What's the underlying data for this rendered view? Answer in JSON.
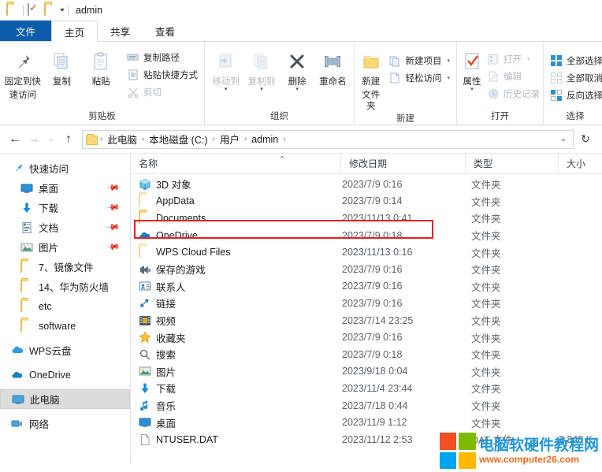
{
  "window": {
    "title": "admin",
    "quick_access": [
      "folder-icon",
      "properties-icon",
      "new-folder-icon",
      "dropdown-caret-icon"
    ]
  },
  "ribbon": {
    "tabs": [
      {
        "label": "文件",
        "kind": "file"
      },
      {
        "label": "主页",
        "kind": "active"
      },
      {
        "label": "共享",
        "kind": "normal"
      },
      {
        "label": "查看",
        "kind": "normal"
      }
    ],
    "groups": [
      {
        "title": "剪贴板",
        "big": [
          {
            "label1": "固定到快",
            "label2": "速访问",
            "icon": "pin-icon"
          },
          {
            "label1": "复制",
            "label2": "",
            "icon": "copy-icon"
          },
          {
            "label1": "粘贴",
            "label2": "",
            "icon": "paste-icon"
          }
        ],
        "small": [
          {
            "label": "复制路径",
            "icon": "copy-path-icon",
            "disabled": false
          },
          {
            "label": "粘贴快捷方式",
            "icon": "paste-shortcut-icon",
            "disabled": false
          },
          {
            "label": "剪切",
            "icon": "scissors-icon",
            "disabled": true
          }
        ]
      },
      {
        "title": "组织",
        "big": [
          {
            "label1": "移动到",
            "label2": "",
            "icon": "move-to-icon",
            "disabled": true,
            "caret": true
          },
          {
            "label1": "复制到",
            "label2": "",
            "icon": "copy-to-icon",
            "disabled": true,
            "caret": true
          },
          {
            "label1": "删除",
            "label2": "",
            "icon": "delete-x-icon",
            "caret": true
          },
          {
            "label1": "重命名",
            "label2": "",
            "icon": "rename-icon"
          }
        ],
        "small": []
      },
      {
        "title": "新建",
        "big": [
          {
            "label1": "新建",
            "label2": "文件夹",
            "icon": "new-folder-icon"
          }
        ],
        "small": [
          {
            "label": "新建项目",
            "icon": "new-item-icon",
            "caret": true
          },
          {
            "label": "轻松访问",
            "icon": "easy-access-icon",
            "caret": true
          }
        ]
      },
      {
        "title": "打开",
        "big": [
          {
            "label1": "属性",
            "label2": "",
            "icon": "properties-icon",
            "caret": true
          }
        ],
        "small": [
          {
            "label": "打开",
            "icon": "open-icon",
            "disabled": true,
            "caret": true
          },
          {
            "label": "编辑",
            "icon": "edit-icon",
            "disabled": true
          },
          {
            "label": "历史记录",
            "icon": "history-icon",
            "disabled": true
          }
        ]
      },
      {
        "title": "选择",
        "big": [],
        "small": [
          {
            "label": "全部选择",
            "icon": "select-all-icon"
          },
          {
            "label": "全部取消",
            "icon": "select-none-icon"
          },
          {
            "label": "反向选择",
            "icon": "invert-selection-icon"
          }
        ]
      }
    ]
  },
  "address": {
    "back": "←",
    "forward": "→",
    "recent_caret": "⌄",
    "up": "↑",
    "crumbs": [
      "此电脑",
      "本地磁盘 (C:)",
      "用户",
      "admin"
    ],
    "dropdown": "⌄",
    "refresh": "↻"
  },
  "columns": {
    "name": "名称",
    "date": "修改日期",
    "type": "类型",
    "size": "大小",
    "sort_indicator": "^"
  },
  "sidebar": {
    "items": [
      {
        "label": "快速访问",
        "icon": "quick-access-star-icon",
        "indent": 0,
        "pin": false,
        "selected": false
      },
      {
        "label": "桌面",
        "icon": "desktop-icon",
        "indent": 1,
        "pin": true,
        "selected": false
      },
      {
        "label": "下载",
        "icon": "download-arrow-icon",
        "indent": 1,
        "pin": true,
        "selected": false
      },
      {
        "label": "文档",
        "icon": "documents-icon",
        "indent": 1,
        "pin": true,
        "selected": false
      },
      {
        "label": "图片",
        "icon": "pictures-icon",
        "indent": 1,
        "pin": true,
        "selected": false
      },
      {
        "label": "7、镜像文件",
        "icon": "folder-icon",
        "indent": 1,
        "pin": false,
        "selected": false
      },
      {
        "label": "14、华为防火墙",
        "icon": "folder-icon",
        "indent": 1,
        "pin": false,
        "selected": false
      },
      {
        "label": "etc",
        "icon": "folder-icon",
        "indent": 1,
        "pin": false,
        "selected": false
      },
      {
        "label": "software",
        "icon": "folder-icon",
        "indent": 1,
        "pin": false,
        "selected": false
      },
      {
        "label": "WPS云盘",
        "icon": "wps-cloud-icon",
        "indent": 0,
        "pin": false,
        "selected": false
      },
      {
        "label": "OneDrive",
        "icon": "onedrive-cloud-icon",
        "indent": 0,
        "pin": false,
        "selected": false
      },
      {
        "label": "此电脑",
        "icon": "this-pc-icon",
        "indent": 0,
        "pin": false,
        "selected": true
      },
      {
        "label": "网络",
        "icon": "network-icon",
        "indent": 0,
        "pin": false,
        "selected": false
      }
    ]
  },
  "files": {
    "rows": [
      {
        "name": "3D 对象",
        "date": "2023/7/9 0:16",
        "type": "文件夹",
        "size": "",
        "icon": "3d-object-icon"
      },
      {
        "name": "AppData",
        "date": "2023/7/9 0:14",
        "type": "文件夹",
        "size": "",
        "icon": "folder-pale-icon"
      },
      {
        "name": "Documents",
        "date": "2023/11/13 0:41",
        "type": "文件夹",
        "size": "",
        "icon": "folder-icon",
        "highlighted": true
      },
      {
        "name": "OneDrive",
        "date": "2023/7/9 0:18",
        "type": "文件夹",
        "size": "",
        "icon": "onedrive-cloud-icon"
      },
      {
        "name": "WPS Cloud Files",
        "date": "2023/11/13 0:16",
        "type": "文件夹",
        "size": "",
        "icon": "folder-pale-icon"
      },
      {
        "name": "保存的游戏",
        "date": "2023/7/9 0:16",
        "type": "文件夹",
        "size": "",
        "icon": "saved-games-icon"
      },
      {
        "name": "联系人",
        "date": "2023/7/9 0:16",
        "type": "文件夹",
        "size": "",
        "icon": "contacts-icon"
      },
      {
        "name": "链接",
        "date": "2023/7/9 0:16",
        "type": "文件夹",
        "size": "",
        "icon": "links-icon"
      },
      {
        "name": "视频",
        "date": "2023/7/14 23:25",
        "type": "文件夹",
        "size": "",
        "icon": "videos-icon"
      },
      {
        "name": "收藏夹",
        "date": "2023/7/9 0:16",
        "type": "文件夹",
        "size": "",
        "icon": "favorites-star-icon"
      },
      {
        "name": "搜索",
        "date": "2023/7/9 0:18",
        "type": "文件夹",
        "size": "",
        "icon": "search-icon"
      },
      {
        "name": "图片",
        "date": "2023/9/18 0:04",
        "type": "文件夹",
        "size": "",
        "icon": "pictures-icon"
      },
      {
        "name": "下载",
        "date": "2023/11/4 23:44",
        "type": "文件夹",
        "size": "",
        "icon": "download-arrow-icon"
      },
      {
        "name": "音乐",
        "date": "2023/7/18 0:44",
        "type": "文件夹",
        "size": "",
        "icon": "music-note-icon"
      },
      {
        "name": "桌面",
        "date": "2023/11/9 1:12",
        "type": "文件夹",
        "size": "",
        "icon": "desktop-icon"
      },
      {
        "name": "NTUSER.DAT",
        "date": "2023/11/12 2:53",
        "type": "DAT 文件",
        "size": "2,848 K",
        "icon": "generic-file-icon"
      }
    ]
  },
  "watermark": {
    "title": "电脑软硬件教程网",
    "url": "www.computer26.com",
    "colors": {
      "title": "#2196d6",
      "url": "#ef6b1f"
    }
  },
  "theme": {
    "file_tab_blue": "#0b5cab",
    "highlight_red": "#ec1c24",
    "selected_gray": "#dcdcdc",
    "folder_yellow": "#fcd976"
  }
}
